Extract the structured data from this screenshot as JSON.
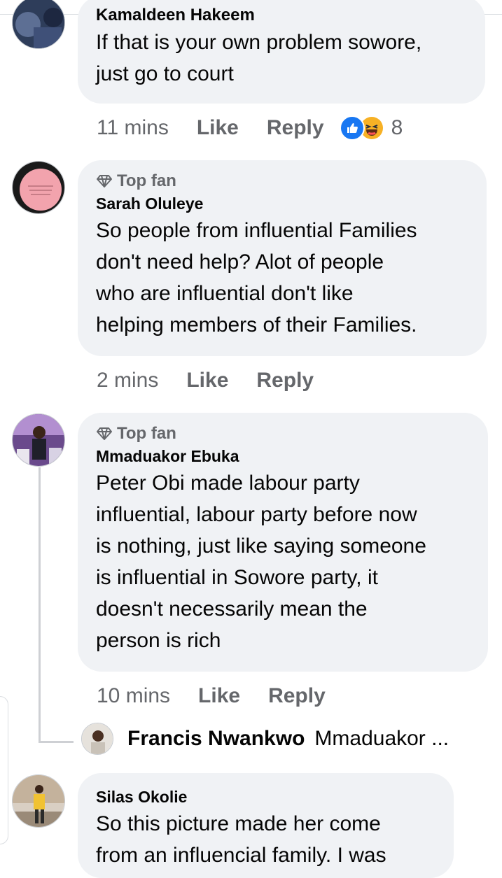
{
  "comments": [
    {
      "author": "Kamaldeen Hakeem",
      "text_lines": [
        "If that is your own problem sowore,",
        "just go to court"
      ],
      "time": "11 mins",
      "like": "Like",
      "reply": "Reply",
      "reactions": [
        "like-icon",
        "haha-icon"
      ],
      "reaction_count": "8"
    },
    {
      "badge": "Top fan",
      "author": "Sarah Oluleye",
      "text_lines": [
        "So people from influential Families",
        "don't need  help? Alot of people",
        "who are  influential  don't like",
        "helping  members of their Families."
      ],
      "time": "2 mins",
      "like": "Like",
      "reply": "Reply"
    },
    {
      "badge": "Top fan",
      "author": "Mmaduakor Ebuka",
      "text_lines": [
        "Peter Obi made labour party",
        "influential, labour party before now",
        "is nothing, just like saying someone",
        "is influential in Sowore party, it",
        "doesn't necessarily mean the",
        "person is rich"
      ],
      "time": "10 mins",
      "like": "Like",
      "reply": "Reply",
      "reply_preview": {
        "author": "Francis Nwankwo",
        "snippet": "Mmaduakor ..."
      }
    },
    {
      "author": "Silas Okolie",
      "text_lines": [
        "So this picture made her come",
        "from an influencial family. I was"
      ]
    }
  ],
  "colors": {
    "bubble": "#f0f2f5",
    "meta_text": "#65676b",
    "like_blue": "#1877f2",
    "haha_yellow": "#f7b125",
    "thread_line": "#ced0d4"
  }
}
